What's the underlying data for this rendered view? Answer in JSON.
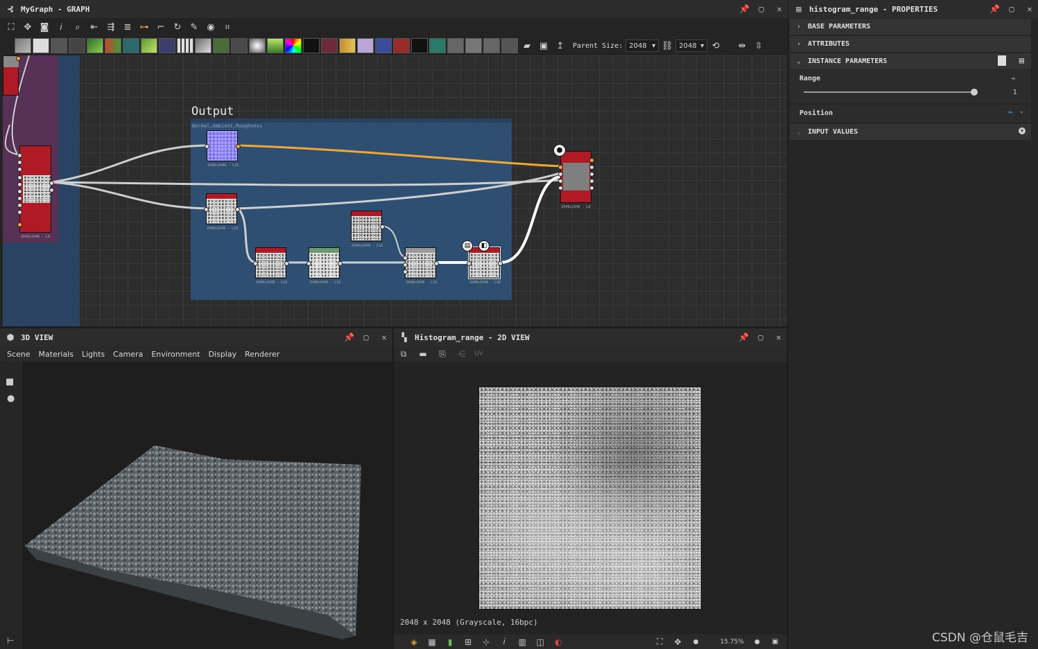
{
  "graph_panel": {
    "title": "MyGraph - GRAPH",
    "parent_size_label": "Parent Size:",
    "parent_size_w": "2048",
    "parent_size_h": "2048",
    "frame_title": "Output",
    "frame_subtitle": "Normal,Ambient,Roughness",
    "node_caption": "2048x2048 - L16",
    "node_caption_out": "2048x2048 - L8"
  },
  "view3d": {
    "title": "3D VIEW",
    "menu": [
      "Scene",
      "Materials",
      "Lights",
      "Camera",
      "Environment",
      "Display",
      "Renderer"
    ]
  },
  "view2d": {
    "title": "Histogram_range - 2D VIEW",
    "uv_label": "UV",
    "info": "2048 x 2048 (Grayscale, 16bpc)",
    "zoom": "15.75%"
  },
  "properties": {
    "title": "histogram_range - PROPERTIES",
    "sections": {
      "base": "BASE PARAMETERS",
      "attributes": "ATTRIBUTES",
      "instance": "INSTANCE PARAMETERS",
      "input_values": "INPUT VALUES"
    },
    "range_label": "Range",
    "range_value": "1",
    "range_fraction": 1.0,
    "position_label": "Position"
  },
  "watermark": "CSDN @仓鼠毛吉",
  "colors": {
    "accent_orange": "#f2a930",
    "node_red": "#b01a24",
    "frame_blue": "#2f4f72",
    "accent_blue": "#3a8fd8"
  }
}
